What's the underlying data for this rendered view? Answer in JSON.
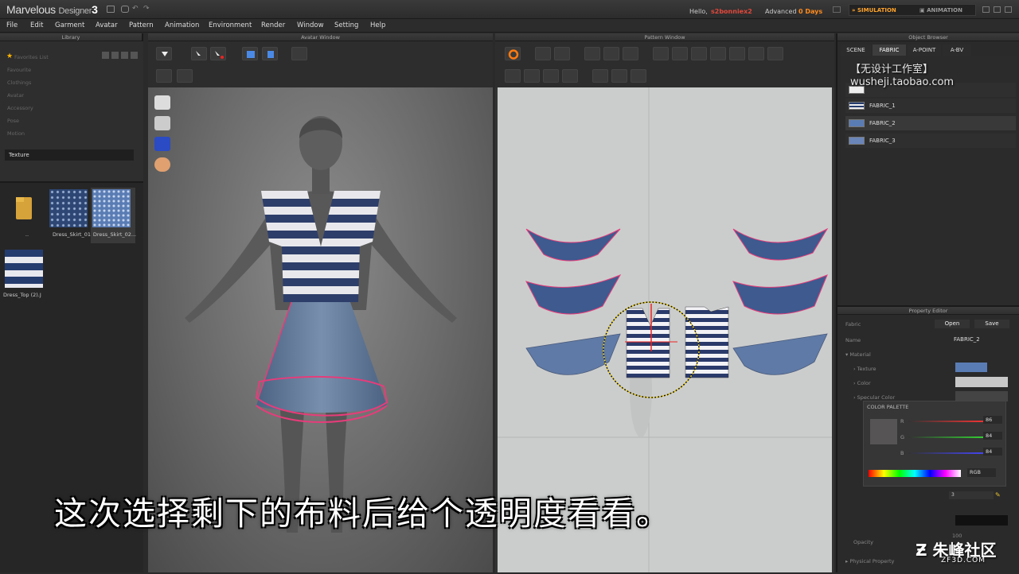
{
  "app": {
    "name": "Marvelous",
    "sub": "Designer",
    "version": "3",
    "hello": "Hello,",
    "user": "s2bonniex2",
    "advanced": "Advanced",
    "days": "0 Days",
    "mode_simulation": "SIMULATION",
    "mode_animation": "ANIMATION"
  },
  "menu": [
    "File",
    "Edit",
    "Garment",
    "Avatar",
    "Pattern",
    "Animation",
    "Environment",
    "Render",
    "Window",
    "Setting",
    "Help"
  ],
  "library": {
    "title": "Library",
    "favorites": "Favorites List",
    "categories": [
      "Favourite",
      "Clothings",
      "Avatar",
      "Accessory",
      "Pose",
      "Motion"
    ],
    "selected_category": "Texture",
    "items": [
      {
        "label": ".."
      },
      {
        "label": "Dress_Skirt_01"
      },
      {
        "label": "Dress_Skirt_02..."
      },
      {
        "label": "Dress_Top (2).J"
      }
    ]
  },
  "avatar_window": {
    "title": "Avatar Window"
  },
  "pattern_window": {
    "title": "Pattern Window"
  },
  "object_browser": {
    "title": "Object Browser",
    "tabs": [
      "SCENE",
      "FABRIC",
      "A-POINT",
      "A-BV"
    ],
    "active_tab": "FABRIC",
    "fabrics": [
      {
        "label": "FABRIC_1"
      },
      {
        "label": "FABRIC_2"
      },
      {
        "label": "FABRIC_3"
      }
    ]
  },
  "property_editor": {
    "title": "Property Editor",
    "fabric_label": "Fabric",
    "open": "Open",
    "save": "Save",
    "name_label": "Name",
    "name_value": "FABRIC_2",
    "material": "Material",
    "texture": "Texture",
    "color": "Color",
    "specular": "Specular Color",
    "palette_title": "COLOR PALETTE",
    "r_label": "R",
    "g_label": "G",
    "b_label": "B",
    "r": "86",
    "g": "84",
    "b": "84",
    "mode": "RGB",
    "opacity_label": "Opacity",
    "opacity_value": "100",
    "physical": "Physical Property",
    "slider_value": "3"
  },
  "overlay": {
    "subtitle": "这次选择剩下的布料后给个透明度看看。",
    "watermark_line1": "【无设计工作室】",
    "watermark_line2": "wusheji.taobao.com",
    "site": "朱峰社区",
    "site_sub": "ZF3D.COM"
  },
  "colors": {
    "accent": "#ff8a1c",
    "pattern_fill": "#3e5a8f",
    "pattern_fill_light": "#5f7aa6",
    "selection": "#e63c7a"
  }
}
